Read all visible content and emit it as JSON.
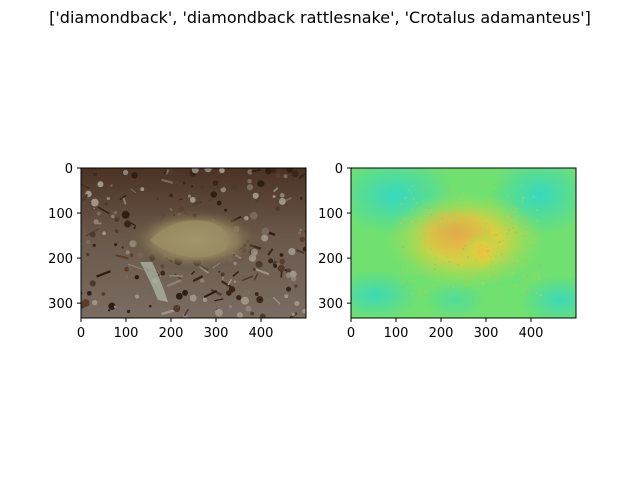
{
  "figure": {
    "title": "['diamondback', 'diamondback rattlesnake', 'Crotalus adamanteus']"
  },
  "chart_data": [
    {
      "type": "heatmap",
      "panel": "original-image",
      "description_of_content": "photo",
      "x_ticks": [
        0,
        100,
        200,
        300,
        400
      ],
      "y_ticks": [
        0,
        100,
        200,
        300
      ],
      "xlim": [
        0,
        500
      ],
      "ylim": [
        333,
        0
      ],
      "grid": false
    },
    {
      "type": "heatmap",
      "panel": "saliency-map",
      "x_ticks": [
        0,
        100,
        200,
        300,
        400
      ],
      "y_ticks": [
        0,
        100,
        200,
        300
      ],
      "xlim": [
        0,
        500
      ],
      "ylim": [
        333,
        0
      ],
      "grid": false
    }
  ]
}
